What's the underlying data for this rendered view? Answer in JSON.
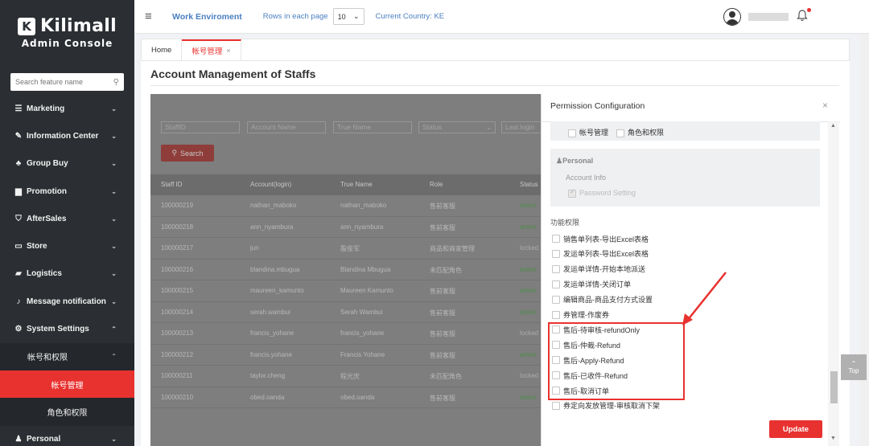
{
  "brand": {
    "logo_letter": "K",
    "name": "Kilimall",
    "subtitle": "Admin Console"
  },
  "sidebar": {
    "search_placeholder": "Search feature name",
    "items": [
      {
        "label": "Marketing",
        "icon": "megaphone-icon",
        "glyph": "☰",
        "chevron": "⌄"
      },
      {
        "label": "Information Center",
        "icon": "info-center-icon",
        "glyph": "✎",
        "chevron": "⌄"
      },
      {
        "label": "Group Buy",
        "icon": "group-icon",
        "glyph": "♣",
        "chevron": "⌄"
      },
      {
        "label": "Promotion",
        "icon": "promotion-icon",
        "glyph": "▆",
        "chevron": "⌄"
      },
      {
        "label": "AfterSales",
        "icon": "shield-icon",
        "glyph": "⛉",
        "chevron": "⌄"
      },
      {
        "label": "Store",
        "icon": "store-icon",
        "glyph": "▭",
        "chevron": "⌄"
      },
      {
        "label": "Logistics",
        "icon": "truck-icon",
        "glyph": "▰",
        "chevron": "⌄"
      },
      {
        "label": "Message notification",
        "icon": "bell-icon",
        "glyph": "♪",
        "chevron": "⌄"
      },
      {
        "label": "System Settings",
        "icon": "settings-icon",
        "glyph": "⚙",
        "chevron": "⌃"
      },
      {
        "label": "帐号和权限",
        "chevron": "⌃"
      },
      {
        "label": "帐号管理"
      },
      {
        "label": "角色和权限"
      },
      {
        "label": "Personal",
        "icon": "person-icon",
        "glyph": "♟",
        "chevron": "⌄"
      }
    ]
  },
  "topbar": {
    "work_environment": "Work Enviroment",
    "rows_label": "Rows in each page",
    "rows_value": "10",
    "country_label": "Current Country:",
    "country_value": "KE"
  },
  "tabs": [
    {
      "label": "Home"
    },
    {
      "label": "帐号管理",
      "close": "×"
    }
  ],
  "page_title": "Account Management of Staffs",
  "filters": {
    "staff_id": "StaffID",
    "account_name": "Account Name",
    "true_name": "True Name",
    "status": "Status",
    "last_login": "Last.login",
    "search_button": "Search"
  },
  "table": {
    "headers": [
      "Staff ID",
      "Account(login)",
      "True Name",
      "Role",
      "Status"
    ],
    "rows": [
      [
        "100000219",
        "nathan_maboko",
        "nathan_maboko",
        "售前客服",
        "active"
      ],
      [
        "100000218",
        "ann_nyambura",
        "ann_nyambura",
        "售前客服",
        "active"
      ],
      [
        "100000217",
        "jun",
        "殷俊军",
        "商品和商家管理",
        "locked"
      ],
      [
        "100000216",
        "blandina.mbugua",
        "Blandina Mbugua",
        "未匹配角色",
        "active"
      ],
      [
        "100000215",
        "maureen_kamunto",
        "Maureen Kamunto",
        "售前客服",
        "active"
      ],
      [
        "100000214",
        "serah.wambui",
        "Serah Wambui",
        "售前客服",
        "active"
      ],
      [
        "100000213",
        "francis_yohane",
        "francis_yohane",
        "售前客服",
        "locked"
      ],
      [
        "100000212",
        "francis.yohane",
        "Francis Yohane",
        "售前客服",
        "active"
      ],
      [
        "100000211",
        "taylor.cheng",
        "程光庆",
        "未匹配角色",
        "locked"
      ],
      [
        "100000210",
        "obed.oanda",
        "obed.oanda",
        "售前客服",
        "active"
      ]
    ]
  },
  "panel": {
    "title": "Permission Configuration",
    "close": "×",
    "top_checks": [
      "帐号管理",
      "角色和权限"
    ],
    "personal_title": "Personal",
    "account_info": "Account Info",
    "password_setting": "Password Setting",
    "function_perms_title": "功能权限",
    "perms": [
      "销售单列表-导出Excel表格",
      "发运单列表-导出Excel表格",
      "发运单详情-开始本地派送",
      "发运单详情-关闭订单",
      "编辑商品-商品支付方式设置",
      "券管理-作废券",
      "售后-待审核-refundOnly",
      "售后-仲裁-Refund",
      "售后-Apply-Refund",
      "售后-已收件-Refund",
      "售后-取消订单",
      "券定向发放管理-审核取消下架"
    ],
    "update_button": "Update"
  },
  "top_button": "Top",
  "colors": {
    "accent": "#e8322f",
    "sidebar": "#2b2f33",
    "link": "#4a7fc1"
  }
}
